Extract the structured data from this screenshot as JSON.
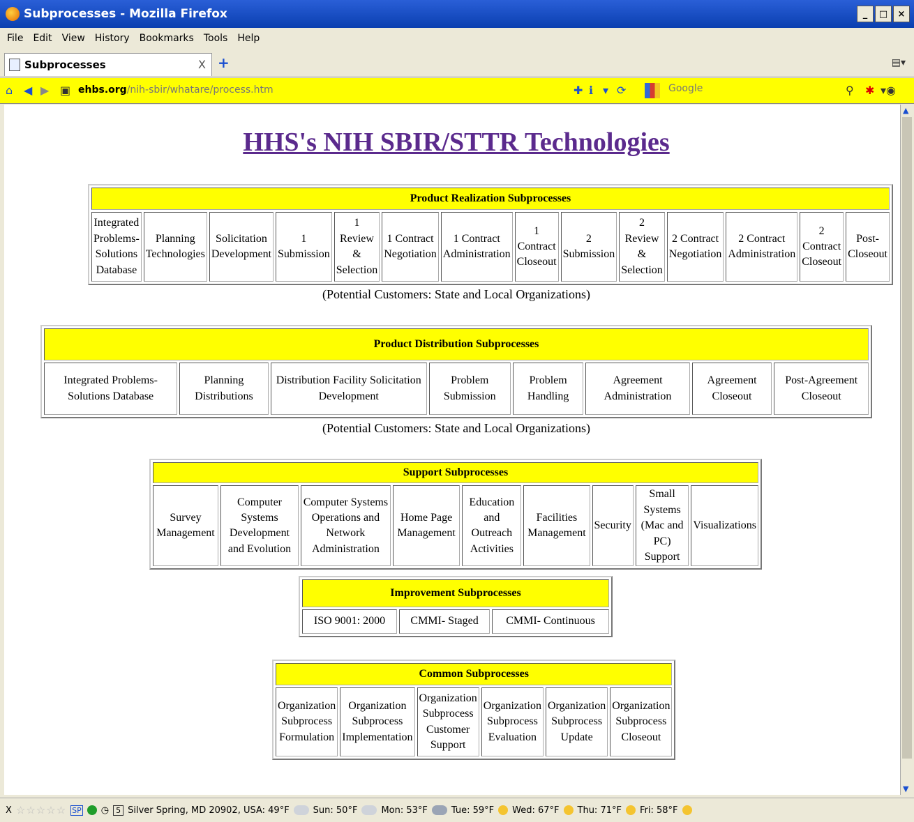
{
  "window": {
    "title": "Subprocesses - Mozilla Firefox",
    "controls": [
      "_",
      "□",
      "×"
    ]
  },
  "menu": [
    "File",
    "Edit",
    "View",
    "History",
    "Bookmarks",
    "Tools",
    "Help"
  ],
  "tab": {
    "label": "Subprocesses",
    "close": "X",
    "new": "+"
  },
  "address": {
    "domain": "ehbs.org",
    "path": "/nih-sbir/whatare/process.htm",
    "search_placeholder": "Google"
  },
  "page": {
    "title": "HHS's NIH SBIR/STTR Technologies",
    "realization": {
      "header": "Product Realization Subprocesses",
      "cells": [
        "Integrated Problems-Solutions Database",
        "Planning Technologies",
        "Solicitation Development",
        "1 Submission",
        "1 Review & Selection",
        "1 Contract Negotiation",
        "1 Contract Administration",
        "1 Contract Closeout",
        "2 Submission",
        "2 Review & Selection",
        "2 Contract Negotiation",
        "2 Contract Administration",
        "2 Contract Closeout",
        "Post-Closeout"
      ],
      "caption": "(Potential Customers: State and Local Organizations)"
    },
    "distribution": {
      "header": "Product Distribution Subprocesses",
      "cells": [
        "Integrated Problems-Solutions Database",
        "Planning Distributions",
        "Distribution Facility Solicitation Development",
        "Problem Submission",
        "Problem Handling",
        "Agreement Administration",
        "Agreement Closeout",
        "Post-Agreement Closeout"
      ],
      "caption": "(Potential Customers: State and Local Organizations)"
    },
    "support": {
      "header": "Support Subprocesses",
      "cells": [
        "Survey Management",
        "Computer Systems Development and Evolution",
        "Computer Systems Operations and Network Administration",
        "Home Page Management",
        "Education and Outreach Activities",
        "Facilities Management",
        "Security",
        "Small Systems (Mac and PC) Support",
        "Visualizations"
      ]
    },
    "improvement": {
      "header": "Improvement Subprocesses",
      "cells": [
        "ISO 9001: 2000",
        "CMMI- Staged",
        "CMMI- Continuous"
      ]
    },
    "common": {
      "header": "Common Subprocesses",
      "cells": [
        "Organization Subprocess Formulation",
        "Organization Subprocess Implementation",
        "Organization Subprocess Customer Support",
        "Organization Subprocess Evaluation",
        "Organization Subprocess Update",
        "Organization Subprocess Closeout"
      ]
    }
  },
  "status": {
    "close": "X",
    "stars": "☆☆☆☆☆",
    "sp": "SP",
    "calendar": "5",
    "location": "Silver Spring, MD 20902, USA: 49°F",
    "forecast": [
      "Sun: 50°F",
      "Mon: 53°F",
      "Tue: 59°F",
      "Wed: 67°F",
      "Thu: 71°F",
      "Fri: 58°F"
    ]
  }
}
